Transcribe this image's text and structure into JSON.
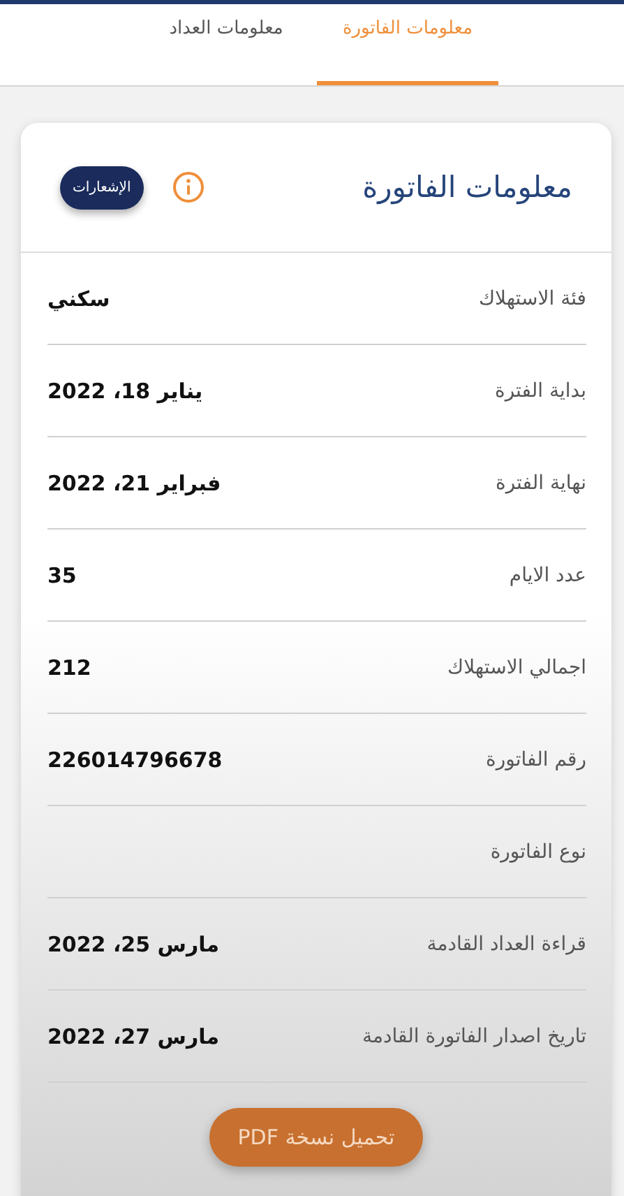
{
  "tabs": [
    {
      "label": "معلومات الفاتورة",
      "selected": true
    },
    {
      "label": "معلومات العداد",
      "selected": false
    }
  ],
  "card": {
    "title": "معلومات الفاتورة",
    "notifications_button": "الإشعارات",
    "rows": [
      {
        "label": "فئة الاستهلاك",
        "value": "سكني"
      },
      {
        "label": "بداية الفترة",
        "value": "يناير 18، 2022"
      },
      {
        "label": "نهاية الفترة",
        "value": "فبراير 21، 2022"
      },
      {
        "label": "عدد الايام",
        "value": "35"
      },
      {
        "label": "اجمالي الاستهلاك",
        "value": "212"
      },
      {
        "label": "رقم الفاتورة",
        "value": "226014796678"
      },
      {
        "label": "نوع الفاتورة"
      },
      {
        "label": "قراءة العداد القادمة",
        "value": "مارس 25، 2022"
      },
      {
        "label": "تاريخ اصدار الفاتورة القادمة",
        "value": "مارس 27، 2022"
      }
    ]
  },
  "download_button": "تحميل نسخة PDF"
}
